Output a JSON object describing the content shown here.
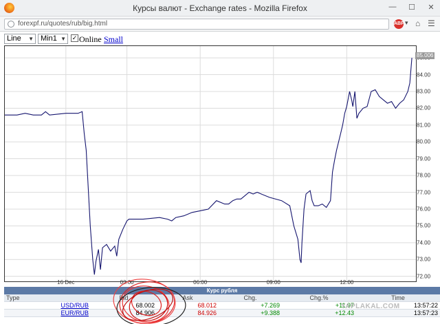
{
  "window": {
    "title": "Курсы валют - Exchange rates - Mozilla Firefox"
  },
  "navbar": {
    "url": "forexpf.ru/quotes/rub/big.html"
  },
  "toolbar": {
    "chart_type": "Line",
    "interval": "Min1",
    "online_label": "Online",
    "small_link": "Small"
  },
  "chart": {
    "y_ticks": [
      "85.00",
      "84.00",
      "83.00",
      "82.00",
      "81.00",
      "80.00",
      "79.00",
      "78.00",
      "77.00",
      "76.00",
      "75.00",
      "74.00",
      "73.00",
      "72.00"
    ],
    "x_ticks": [
      "16 Dec",
      "03:00",
      "06:00",
      "09:00",
      "12:00"
    ],
    "last_value": "85.006",
    "line_color": "#14146e"
  },
  "chart_data": {
    "type": "line",
    "title": "",
    "xlabel": "",
    "ylabel": "",
    "ylim": [
      71.7,
      85.7
    ],
    "xlim": [
      0,
      101
    ],
    "x_ticks": [
      {
        "label": "16 Dec",
        "x": 15
      },
      {
        "label": "03:00",
        "x": 30
      },
      {
        "label": "06:00",
        "x": 48
      },
      {
        "label": "09:00",
        "x": 66
      },
      {
        "label": "12:00",
        "x": 84
      }
    ],
    "series": [
      {
        "values": [
          [
            0,
            81.6
          ],
          [
            3,
            81.6
          ],
          [
            5,
            81.7
          ],
          [
            7,
            81.6
          ],
          [
            9,
            81.6
          ],
          [
            10,
            81.8
          ],
          [
            11,
            81.6
          ],
          [
            15,
            81.7
          ],
          [
            18,
            81.7
          ],
          [
            19,
            81.8
          ],
          [
            19.5,
            80.5
          ],
          [
            20,
            79.5
          ],
          [
            21,
            75.0
          ],
          [
            21.6,
            73.0
          ],
          [
            22,
            72.1
          ],
          [
            22.4,
            72.9
          ],
          [
            23,
            73.6
          ],
          [
            23.5,
            72.4
          ],
          [
            24,
            73.7
          ],
          [
            25,
            73.9
          ],
          [
            26,
            73.5
          ],
          [
            27,
            73.8
          ],
          [
            27.5,
            73.2
          ],
          [
            28,
            74.2
          ],
          [
            29,
            74.8
          ],
          [
            30,
            75.3
          ],
          [
            30.5,
            75.4
          ],
          [
            34,
            75.4
          ],
          [
            38,
            75.5
          ],
          [
            40,
            75.4
          ],
          [
            41,
            75.3
          ],
          [
            42,
            75.5
          ],
          [
            44,
            75.6
          ],
          [
            46,
            75.8
          ],
          [
            48,
            75.9
          ],
          [
            50,
            76.0
          ],
          [
            52,
            76.5
          ],
          [
            54,
            76.3
          ],
          [
            55,
            76.3
          ],
          [
            56,
            76.5
          ],
          [
            57,
            76.6
          ],
          [
            58,
            76.6
          ],
          [
            59,
            76.8
          ],
          [
            60,
            77.0
          ],
          [
            61,
            76.9
          ],
          [
            62,
            77.0
          ],
          [
            63,
            76.9
          ],
          [
            65,
            76.7
          ],
          [
            68,
            76.5
          ],
          [
            70,
            76.2
          ],
          [
            71,
            75.0
          ],
          [
            72,
            74.2
          ],
          [
            72.5,
            73.0
          ],
          [
            72.8,
            72.8
          ],
          [
            73,
            74.0
          ],
          [
            73.5,
            76.0
          ],
          [
            74,
            76.9
          ],
          [
            75,
            77.1
          ],
          [
            75.5,
            76.5
          ],
          [
            76,
            76.2
          ],
          [
            77,
            76.2
          ],
          [
            78,
            76.3
          ],
          [
            79,
            76.1
          ],
          [
            80,
            76.5
          ],
          [
            80.5,
            78.2
          ],
          [
            81,
            78.9
          ],
          [
            81.5,
            79.5
          ],
          [
            82,
            80.0
          ],
          [
            82.5,
            80.5
          ],
          [
            83,
            81.0
          ],
          [
            83.5,
            81.7
          ],
          [
            84,
            82.1
          ],
          [
            84.7,
            83.0
          ],
          [
            85.2,
            82.5
          ],
          [
            85.5,
            82.1
          ],
          [
            86,
            83.0
          ],
          [
            86.5,
            81.4
          ],
          [
            87,
            81.7
          ],
          [
            88,
            82.0
          ],
          [
            89,
            82.1
          ],
          [
            90,
            83.0
          ],
          [
            91,
            83.1
          ],
          [
            92,
            82.7
          ],
          [
            93,
            82.5
          ],
          [
            94,
            82.3
          ],
          [
            95,
            82.4
          ],
          [
            96,
            82.0
          ],
          [
            97,
            82.3
          ],
          [
            98,
            82.5
          ],
          [
            99,
            83.0
          ],
          [
            99.5,
            83.5
          ],
          [
            100,
            85.0
          ]
        ]
      }
    ]
  },
  "table": {
    "caption": "Курс рубля",
    "headers": [
      "Type",
      "Bid",
      "Ask",
      "Chg.",
      "Chg.%",
      "Time"
    ],
    "rows": [
      {
        "type": "USD/RUB",
        "bid": "68.002",
        "ask": "68.012",
        "chg": "+7.269",
        "chgp": "+11.97",
        "time": "13:57:22"
      },
      {
        "type": "EUR/RUB",
        "bid": "84.906",
        "ask": "84.926",
        "chg": "+9.388",
        "chgp": "+12.43",
        "time": "13:57:23"
      }
    ]
  },
  "watermark": "YAPLAKAL.COM"
}
